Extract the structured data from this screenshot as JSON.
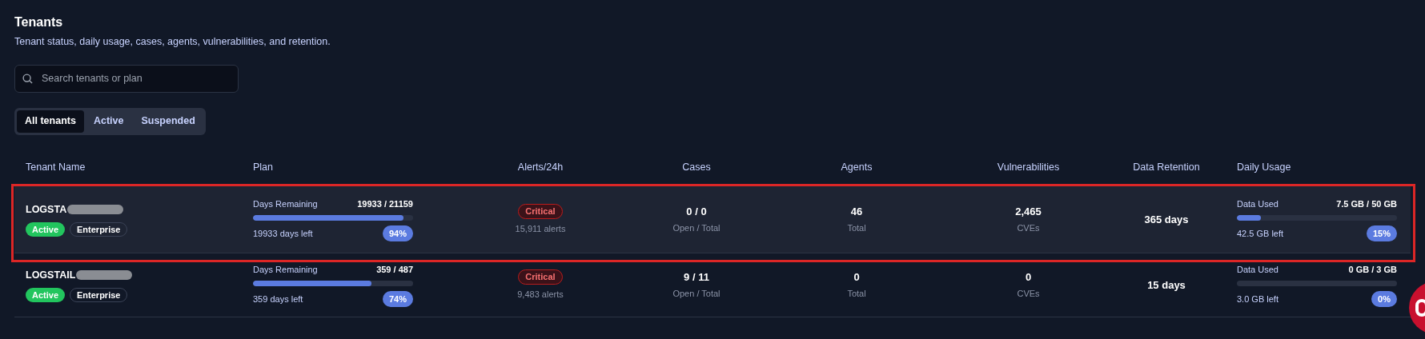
{
  "header": {
    "title": "Tenants",
    "subtitle": "Tenant status, daily usage, cases, agents, vulnerabilities, and retention."
  },
  "search": {
    "placeholder": "Search tenants or plan"
  },
  "filters": [
    {
      "label": "All tenants",
      "selected": true
    },
    {
      "label": "Active",
      "selected": false
    },
    {
      "label": "Suspended",
      "selected": false
    }
  ],
  "table": {
    "columns": [
      "Tenant Name",
      "Plan",
      "Alerts/24h",
      "Cases",
      "Agents",
      "Vulnerabilities",
      "Data Retention",
      "Daily Usage"
    ],
    "rows": [
      {
        "name": "LOGSTA",
        "redacted": true,
        "highlighted": true,
        "status": "Active",
        "tier": "Enterprise",
        "plan": {
          "label": "Days Remaining",
          "value": "19933 / 21159",
          "level": 0.94,
          "left": "19933 days left",
          "percent": "94%"
        },
        "alert": {
          "severity": "Critical",
          "count": "15,911 alerts"
        },
        "cases": {
          "value": "0 / 0",
          "caption": "Open / Total"
        },
        "agents": {
          "value": "46",
          "caption": "Total"
        },
        "vulnerabilities": {
          "value": "2,465",
          "caption": "CVEs"
        },
        "retention": "365 days",
        "usage": {
          "label": "Data Used",
          "value": "7.5 GB / 50 GB",
          "level": 0.15,
          "left": "42.5 GB left",
          "percent": "15%"
        }
      },
      {
        "name": "LOGSTAIL",
        "redacted": true,
        "highlighted": false,
        "status": "Active",
        "tier": "Enterprise",
        "plan": {
          "label": "Days Remaining",
          "value": "359 / 487",
          "level": 0.74,
          "left": "359 days left",
          "percent": "74%"
        },
        "alert": {
          "severity": "Critical",
          "count": "9,483 alerts"
        },
        "cases": {
          "value": "9 / 11",
          "caption": "Open / Total"
        },
        "agents": {
          "value": "0",
          "caption": "Total"
        },
        "vulnerabilities": {
          "value": "0",
          "caption": "CVEs"
        },
        "retention": "15 days",
        "usage": {
          "label": "Data Used",
          "value": "0 GB / 3 GB",
          "level": 0,
          "left": "3.0 GB left",
          "percent": "0%"
        }
      }
    ]
  }
}
